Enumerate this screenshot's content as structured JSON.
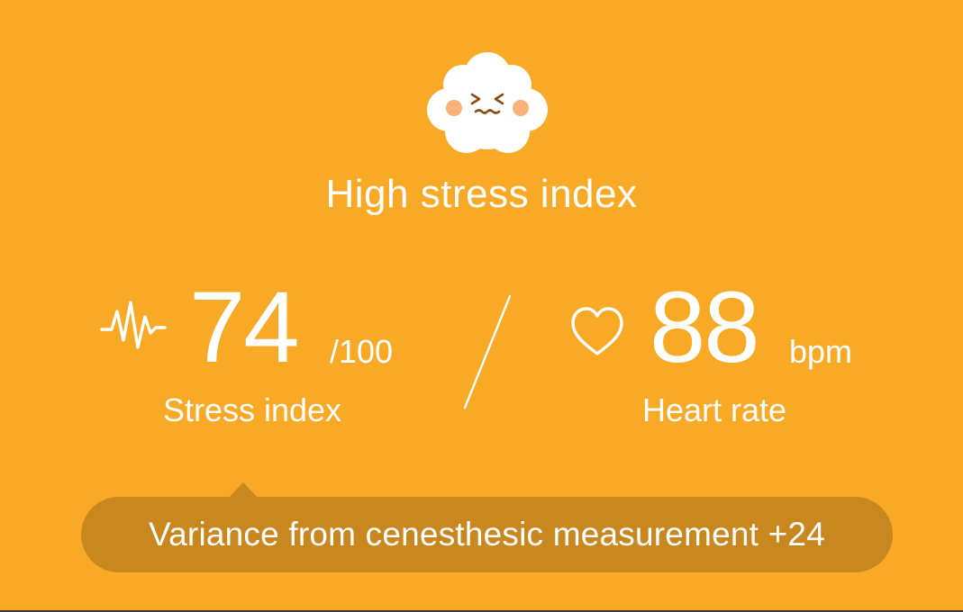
{
  "status": {
    "title": "High stress index",
    "mascot_icon": "stressed-cloud-face-icon"
  },
  "stress": {
    "icon": "pulse-wave-icon",
    "value": "74",
    "unit": "/100",
    "label": "Stress index"
  },
  "heart": {
    "icon": "heart-outline-icon",
    "value": "88",
    "unit": "bpm",
    "label": "Heart rate"
  },
  "tooltip": {
    "text": "Variance from cenesthesic measurement +24"
  },
  "colors": {
    "background": "#F8AA27",
    "tooltip_background": "#C8871F",
    "foreground": "#FFFFFF",
    "cheek": "#F9B27A",
    "face_features": "#8A4A12"
  }
}
